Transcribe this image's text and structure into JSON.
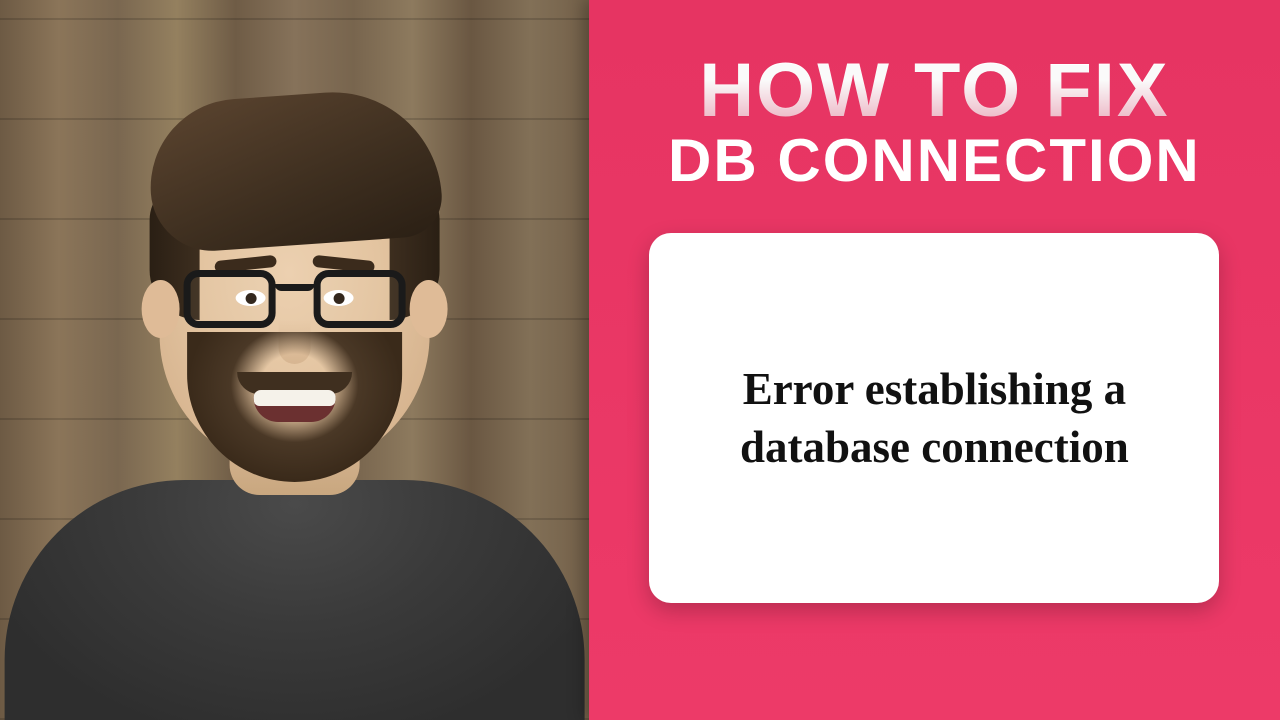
{
  "title": {
    "line1": "HOW TO FIX",
    "line2": "DB CONNECTION"
  },
  "errorBox": {
    "message": "Error establishing a database connection"
  },
  "colors": {
    "accent": "#e63462",
    "panel_bg": "#ffffff",
    "text_dark": "#111111"
  }
}
